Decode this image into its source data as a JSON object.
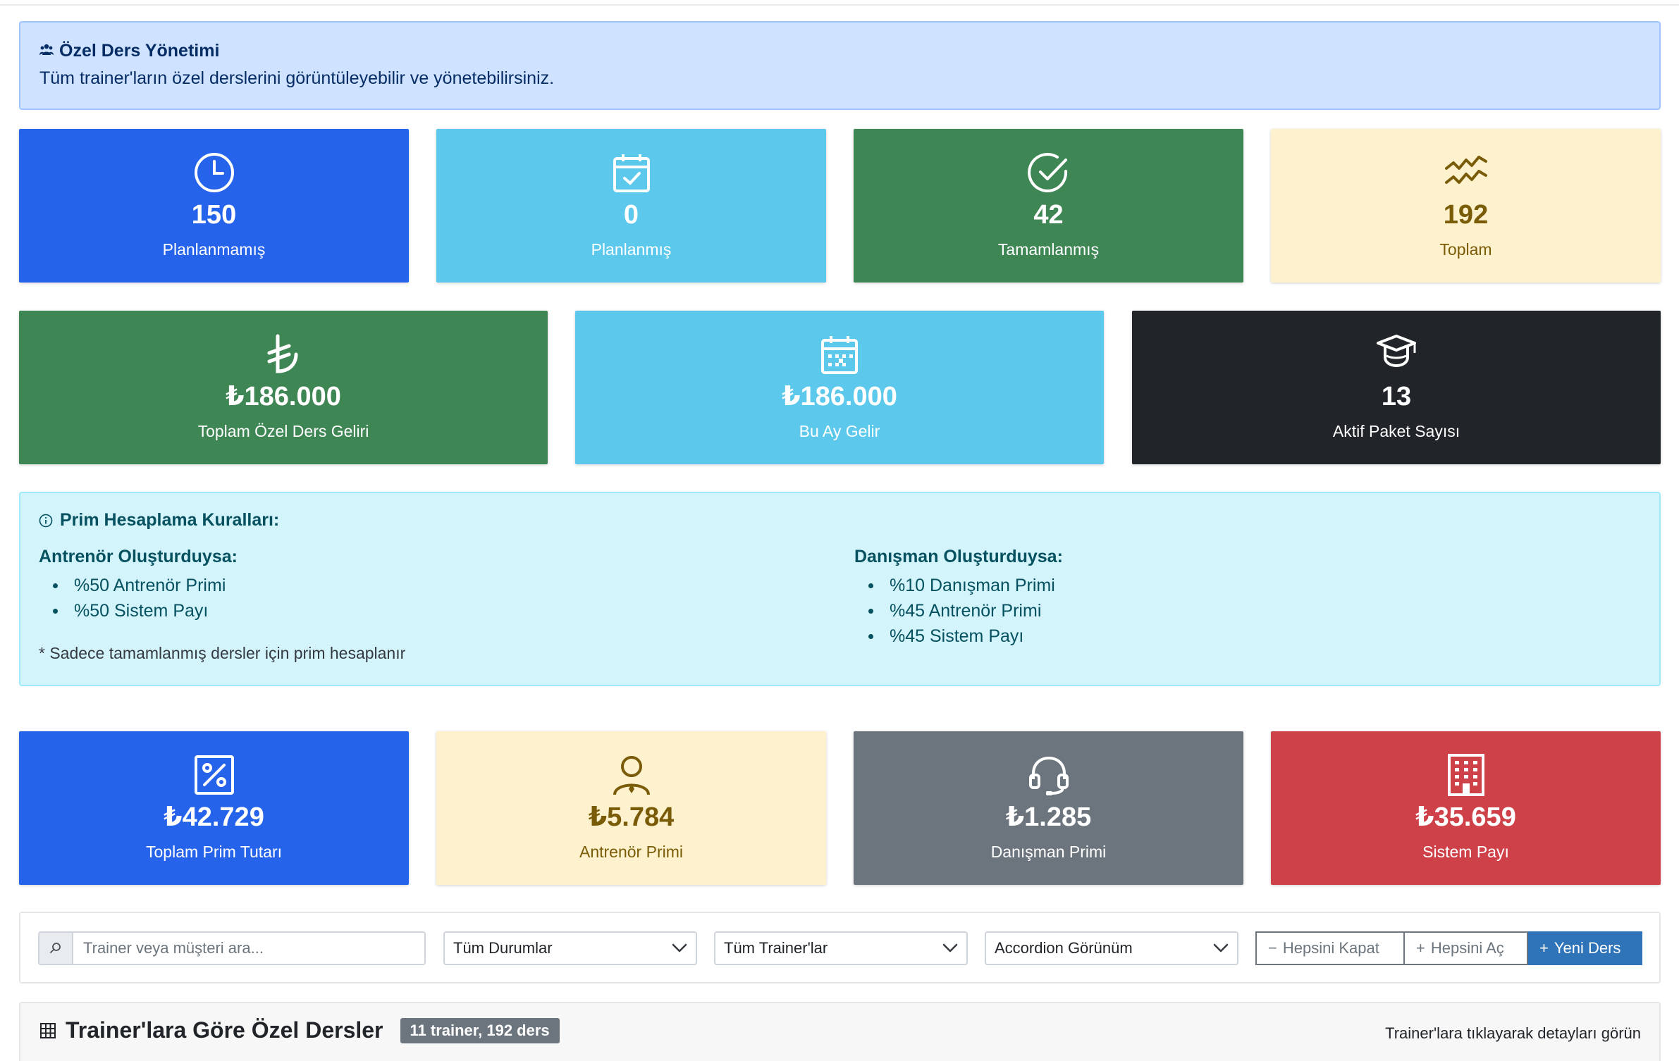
{
  "header": {
    "icon": "group-icon",
    "title": "Özel Ders Yönetimi",
    "description": "Tüm trainer'ların özel derslerini görüntüleyebilir ve yönetebilirsiniz."
  },
  "status_cards": [
    {
      "value": "150",
      "label": "Planlanmamış",
      "icon": "clock-icon"
    },
    {
      "value": "0",
      "label": "Planlanmış",
      "icon": "calendar-check-icon"
    },
    {
      "value": "42",
      "label": "Tamamlanmış",
      "icon": "check-circle-icon"
    },
    {
      "value": "192",
      "label": "Toplam",
      "icon": "activity-icon"
    }
  ],
  "revenue_cards": [
    {
      "value": "₺186.000",
      "label": "Toplam Özel Ders Geliri",
      "icon": "lira-icon"
    },
    {
      "value": "₺186.000",
      "label": "Bu Ay Gelir",
      "icon": "calendar-icon"
    },
    {
      "value": "13",
      "label": "Aktif Paket Sayısı",
      "icon": "mortarboard-icon"
    }
  ],
  "rules": {
    "title": "Prim Hesaplama Kuralları:",
    "trainer": {
      "heading": "Antrenör Oluşturduysa:",
      "items": [
        "%50 Antrenör Primi",
        "%50 Sistem Payı"
      ]
    },
    "consultant": {
      "heading": "Danışman Oluşturduysa:",
      "items": [
        "%10 Danışman Primi",
        "%45 Antrenör Primi",
        "%45 Sistem Payı"
      ]
    },
    "note": "* Sadece tamamlanmış dersler için prim hesaplanır"
  },
  "commission_cards": [
    {
      "value": "₺42.729",
      "label": "Toplam Prim Tutarı",
      "icon": "percent-icon"
    },
    {
      "value": "₺5.784",
      "label": "Antrenör Primi",
      "icon": "person-icon"
    },
    {
      "value": "₺1.285",
      "label": "Danışman Primi",
      "icon": "headset-icon"
    },
    {
      "value": "₺35.659",
      "label": "Sistem Payı",
      "icon": "building-icon"
    }
  ],
  "filters": {
    "search_placeholder": "Trainer veya müşteri ara...",
    "status_select": "Tüm Durumlar",
    "trainer_select": "Tüm Trainer'lar",
    "view_select": "Accordion Görünüm",
    "collapse_all": "Hepsini Kapat",
    "expand_all": "Hepsini Aç",
    "new_lesson": "Yeni Ders"
  },
  "section": {
    "title": "Trainer'lara Göre Özel Dersler",
    "badge": "11 trainer, 192 ders",
    "hint": "Trainer'lara tıklayarak detayları görün"
  },
  "colors": {
    "blue": "#2563eb",
    "cyan": "#5bc8ec",
    "green": "#3f8655",
    "yellow": "#fdf2cd",
    "dark": "#212529",
    "gray": "#6c757d",
    "red": "#cf4149"
  }
}
